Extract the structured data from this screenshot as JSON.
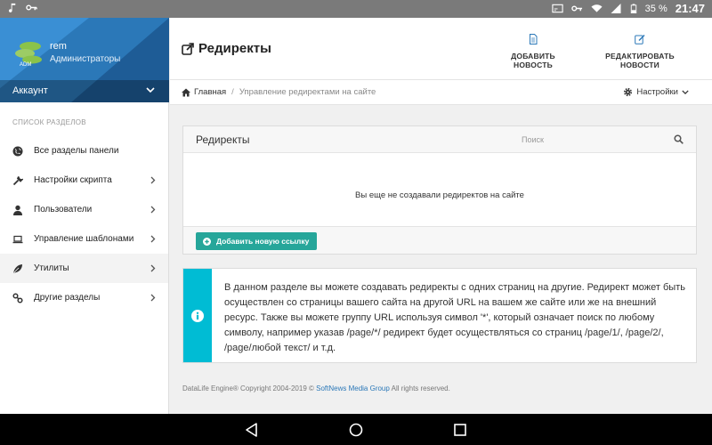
{
  "status_bar": {
    "battery": "35 %",
    "time": "21:47"
  },
  "sidebar": {
    "profile": {
      "name": "rem",
      "role": "Администраторы",
      "account_label": "Аккаунт"
    },
    "section_title": "СПИСОК РАЗДЕЛОВ",
    "items": [
      {
        "label": "Все разделы панели",
        "icon": "globe-icon"
      },
      {
        "label": "Настройки скрипта",
        "icon": "wrench-icon"
      },
      {
        "label": "Пользователи",
        "icon": "user-icon"
      },
      {
        "label": "Управление шаблонами",
        "icon": "laptop-icon"
      },
      {
        "label": "Утилиты",
        "icon": "leaf-icon"
      },
      {
        "label": "Другие разделы",
        "icon": "link-icon"
      }
    ]
  },
  "header": {
    "title": "Редиректы",
    "actions": {
      "add_news": "ДОБАВИТЬ НОВОСТЬ",
      "edit_news": "РЕДАКТИРОВАТЬ НОВОСТИ"
    }
  },
  "breadcrumb": {
    "home": "Главная",
    "separator": "/",
    "current": "Управление редиректами на сайте",
    "settings": "Настройки"
  },
  "redirects_panel": {
    "title": "Редиректы",
    "search_placeholder": "Поиск",
    "empty_message": "Вы еще не создавали редиректов на сайте",
    "add_button": "Добавить новую ссылку"
  },
  "info": {
    "text": "В данном разделе вы можете создавать редиректы с одних страниц на другие. Редирект может быть осуществлен со страницы вашего сайта на другой URL на вашем же сайте или же на внешний ресурс. Также вы можете группу URL используя символ '*', который означает поиск по любому символу, например указав /page/*/ редирект будет осуществляться со страниц /page/1/, /page/2/, /page/любой текст/ и т.д."
  },
  "footer": {
    "prefix": "DataLife Engine® Copyright 2004-2019 ©",
    "link": "SoftNews Media Group",
    "suffix": "All rights reserved."
  },
  "colors": {
    "primary": "#2b78b8",
    "accent": "#26a69a",
    "info": "#00bcd4"
  }
}
